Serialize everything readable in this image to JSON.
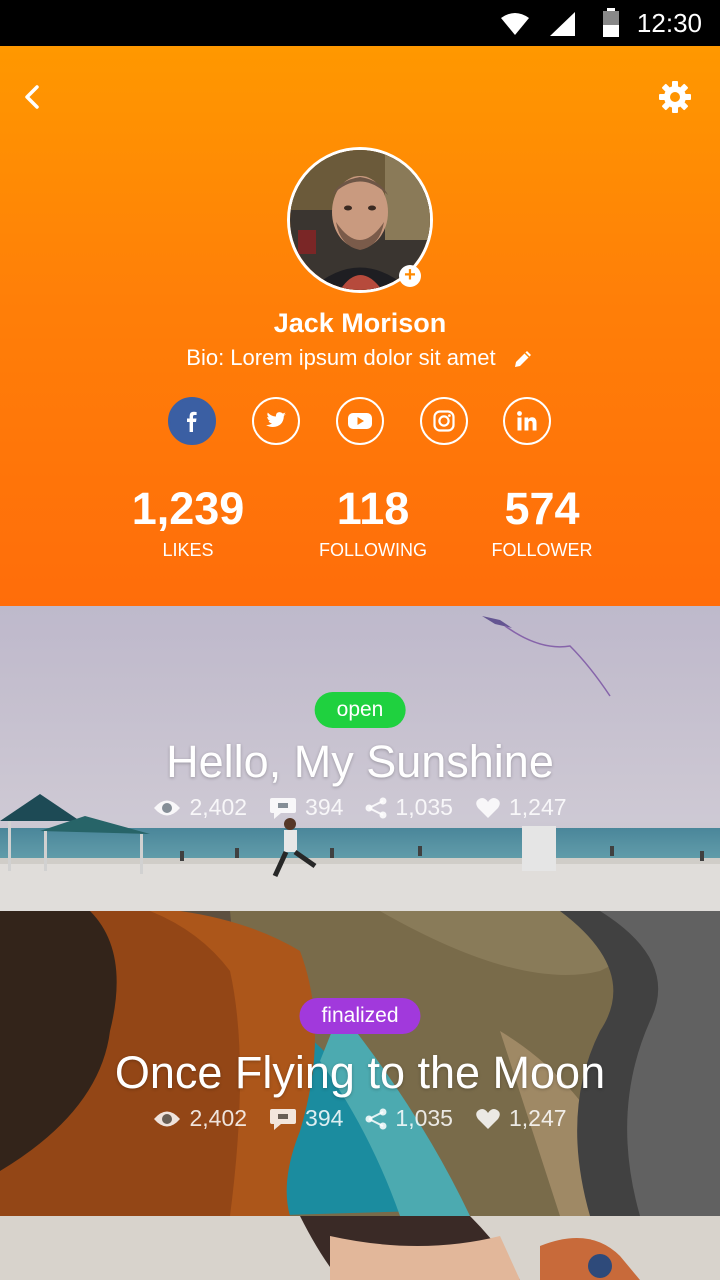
{
  "status_bar": {
    "time": "12:30"
  },
  "profile": {
    "name": "Jack Morison",
    "bio": "Bio: Lorem ipsum dolor sit amet",
    "avatar_add": "+"
  },
  "social": [
    "facebook-icon",
    "twitter-icon",
    "youtube-icon",
    "instagram-icon",
    "linkedin-icon"
  ],
  "stats": [
    {
      "value": "1,239",
      "label": "LIKES"
    },
    {
      "value": "118",
      "label": "FOLLOWING"
    },
    {
      "value": "574",
      "label": "FOLLOWER"
    }
  ],
  "cards": [
    {
      "status": "open",
      "title": "Hello, My Sunshine",
      "views": "2,402",
      "comments": "394",
      "shares": "1,035",
      "likes": "1,247"
    },
    {
      "status": "finalized",
      "title": "Once Flying to the Moon",
      "views": "2,402",
      "comments": "394",
      "shares": "1,035",
      "likes": "1,247"
    }
  ],
  "colors": {
    "accent": "#ff8a00",
    "open": "#1fd13f",
    "finalized": "#a139dc",
    "facebook": "#3b5fa3"
  }
}
